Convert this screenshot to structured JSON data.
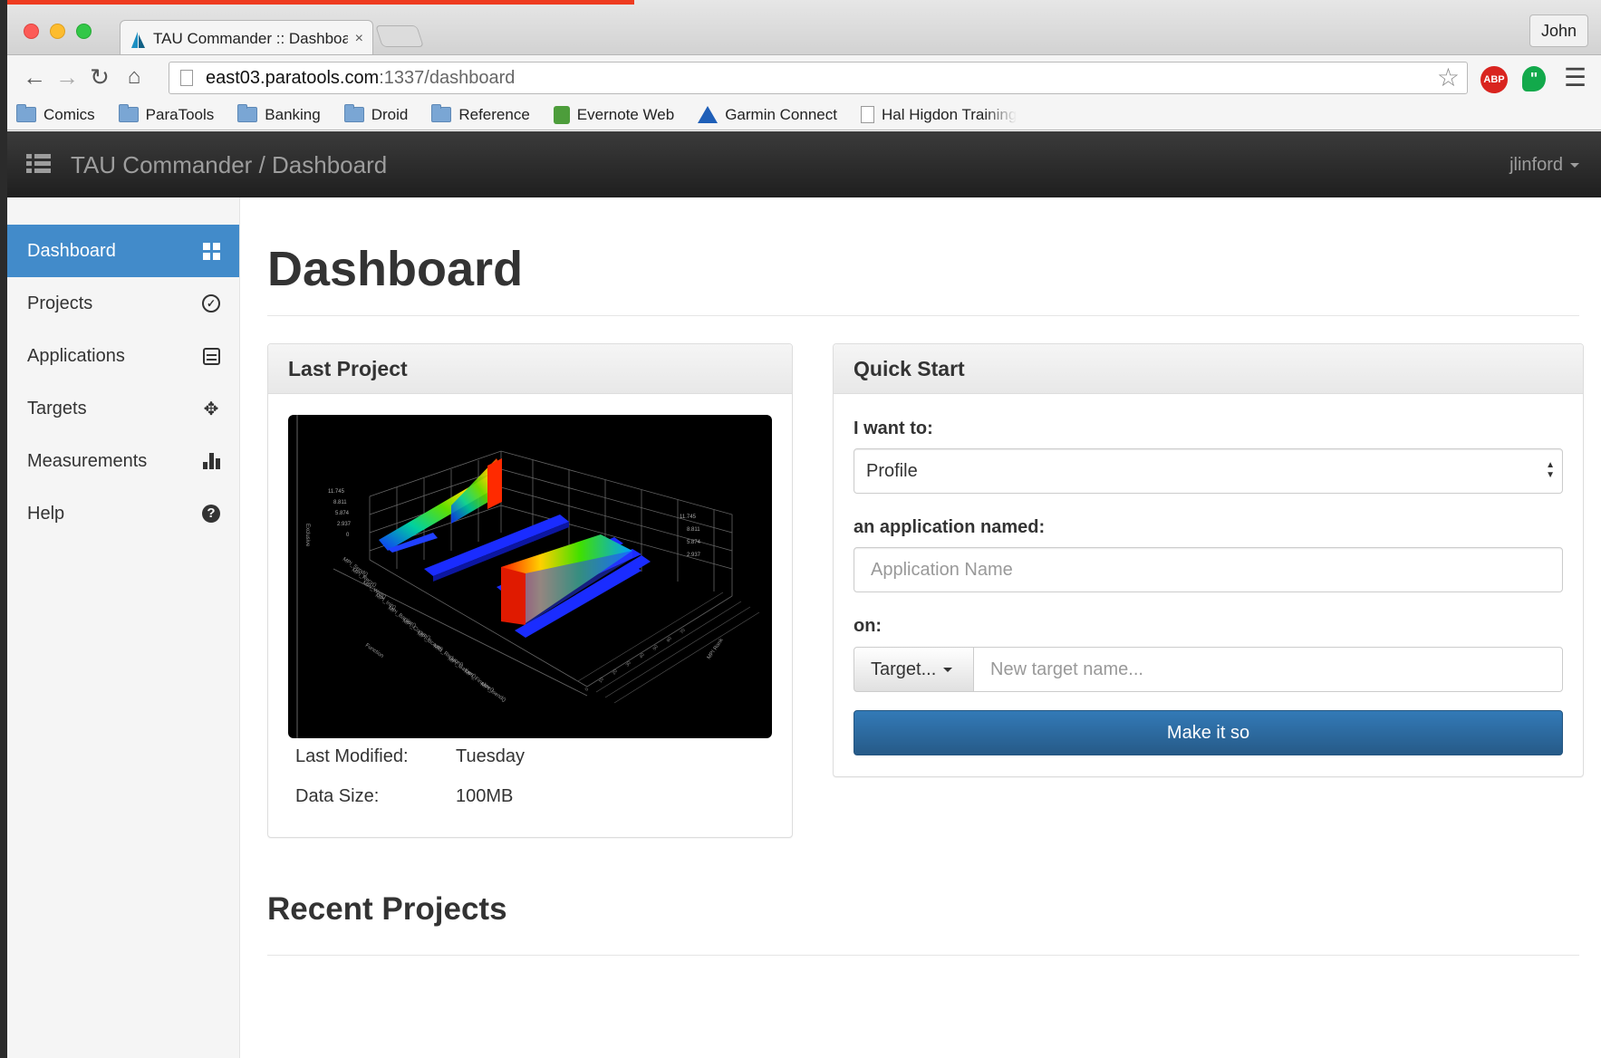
{
  "browser": {
    "tab_title": "TAU Commander :: Dashboard",
    "tab_close": "×",
    "profile_name": "John",
    "url_host": "east03.paratools.com",
    "url_path": ":1337/dashboard",
    "bookmarks": [
      "Comics",
      "ParaTools",
      "Banking",
      "Droid",
      "Reference",
      "Evernote Web",
      "Garmin Connect",
      "Hal Higdon Training"
    ],
    "ext_abp": "ABP",
    "ext_hangouts": "\""
  },
  "navbar": {
    "brand": "TAU Commander / Dashboard",
    "user": "jlinford"
  },
  "sidebar": {
    "items": [
      {
        "label": "Dashboard",
        "icon": "dashboard-icon",
        "active": true
      },
      {
        "label": "Projects",
        "icon": "check-circle-icon"
      },
      {
        "label": "Applications",
        "icon": "application-icon"
      },
      {
        "label": "Targets",
        "icon": "target-icon"
      },
      {
        "label": "Measurements",
        "icon": "bar-chart-icon"
      },
      {
        "label": "Help",
        "icon": "help-icon"
      }
    ]
  },
  "main": {
    "title": "Dashboard",
    "last_project": {
      "heading": "Last Project",
      "modified_label": "Last Modified:",
      "modified_value": "Tuesday",
      "size_label": "Data Size:",
      "size_value": "100MB"
    },
    "quick_start": {
      "heading": "Quick Start",
      "want_label": "I want to:",
      "want_value": "Profile",
      "app_label": "an application named:",
      "app_placeholder": "Application Name",
      "on_label": "on:",
      "target_button": "Target...",
      "target_placeholder": "New target name...",
      "submit": "Make it so"
    },
    "recent_title": "Recent Projects"
  },
  "colors": {
    "accent": "#428bca",
    "primary_button": "#337ab7",
    "navbar": "#222222"
  }
}
